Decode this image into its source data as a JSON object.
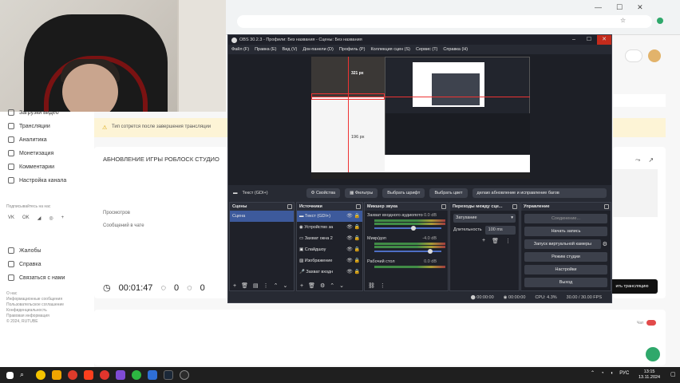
{
  "browser": {
    "toolbar_icons": [
      "minimize-icon",
      "restore-icon",
      "close-icon"
    ]
  },
  "sidebar": {
    "items": [
      {
        "label": "Загрузки видео",
        "icon": "video-icon"
      },
      {
        "label": "Трансляции",
        "icon": "broadcast-icon"
      },
      {
        "label": "Аналитика",
        "icon": "chart-icon"
      },
      {
        "label": "Монетизация",
        "icon": "money-icon"
      },
      {
        "label": "Комментарии",
        "icon": "comment-icon"
      },
      {
        "label": "Настройка канала",
        "icon": "settings-icon"
      }
    ],
    "social_heading": "Подписывайтесь на нас",
    "bottom_items": [
      {
        "label": "Жалобы",
        "icon": "flag-icon"
      },
      {
        "label": "Справка",
        "icon": "help-icon"
      },
      {
        "label": "Связаться с нами",
        "icon": "mail-icon"
      }
    ],
    "footer_links": [
      "О нас",
      "Информационные сообщения",
      "Пользовательское соглашение",
      "Конфиденциальность",
      "Правовая информация"
    ],
    "copyright": "© 2024, RUTUBE"
  },
  "studio": {
    "warning": "Тип сотрется после завершения трансляции",
    "stream_title": "АБНОВЛЕНИЕ ИГРЫ РОБЛОСК СТУДИО",
    "views_label": "Просмотров",
    "chat_label": "Сообщений в чате",
    "timer": "00:01:47",
    "likes": "0",
    "dislikes": "0",
    "finish_button": "ить трансляцию",
    "chat_toggle_label": "Чат"
  },
  "obs": {
    "title": "OBS 30.2.3 - Профили: Без названия - Сцены: Без названия",
    "menu": [
      "Файл (F)",
      "Правка (E)",
      "Вид (V)",
      "Док-панели (D)",
      "Профиль (P)",
      "Коллекция сцен (S)",
      "Сервис (T)",
      "Справка (H)"
    ],
    "preview_label_1": "321 px",
    "preview_label_2": "196 px",
    "source_bar": {
      "source_name": "Текст (GDI+)",
      "properties": "Свойства",
      "filters": "Фильтры",
      "font": "Выбрать шрифт",
      "color": "Выбрать цвет",
      "text": "делаю абновление и исправление багов"
    },
    "scenes": {
      "title": "Сцены",
      "items": [
        "Сцена"
      ]
    },
    "sources": {
      "title": "Источники",
      "items": [
        "Текст (GDI+)",
        "Устройство за",
        "Захват окна 2",
        "Слайдшоу",
        "Изображение",
        "Захват входн"
      ]
    },
    "mixer": {
      "title": "Микшер звука",
      "channels": [
        {
          "name": "Захват входного аудиопото",
          "db": "0.0 dB",
          "level": 0.55
        },
        {
          "name": "Микр/доп",
          "db": "-4.0 dB",
          "level": 0.8
        },
        {
          "name": "Рабочий стол",
          "db": "0.0 dB",
          "level": 0.55
        }
      ]
    },
    "transitions": {
      "title": "Переходы между сце...",
      "type": "Затухание",
      "duration_label": "Длительность",
      "duration": "100 ms"
    },
    "controls": {
      "title": "Управление",
      "buttons": [
        "Соединение...",
        "Начать запись",
        "Запуск виртуальной камеры",
        "Режим студии",
        "Настройки",
        "Выход"
      ]
    },
    "status": {
      "rec": "00:00:00",
      "stream": "00:00:00",
      "cpu": "CPU: 4.3%",
      "fps": "30.00 / 30.00 FPS"
    }
  },
  "taskbar": {
    "time": "13:15",
    "date": "13.11.2024",
    "lang": "РУС"
  }
}
